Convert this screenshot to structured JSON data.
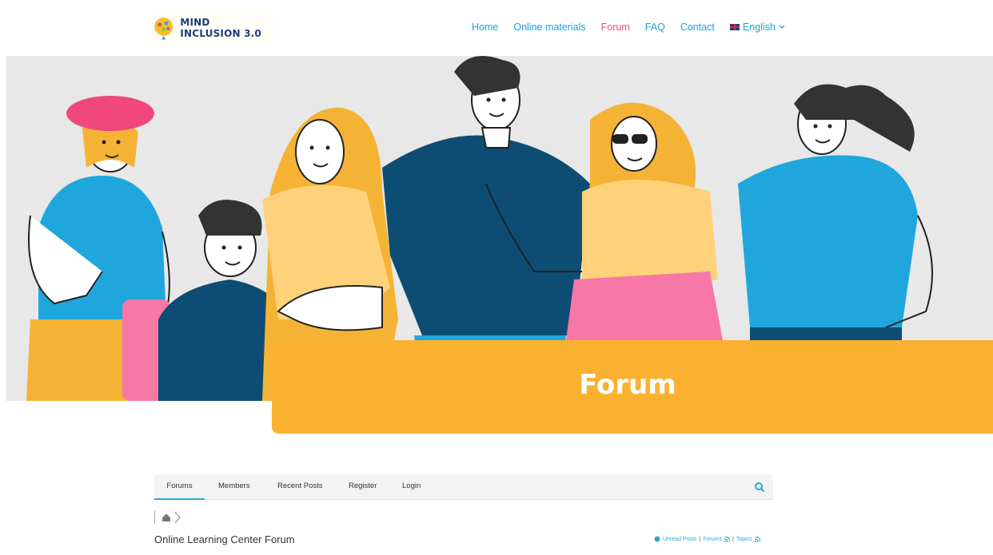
{
  "site": {
    "logo_text": "MIND INCLUSION 3.0"
  },
  "nav": {
    "items": [
      {
        "label": "Home"
      },
      {
        "label": "Online materials"
      },
      {
        "label": "Forum"
      },
      {
        "label": "FAQ"
      },
      {
        "label": "Contact"
      }
    ],
    "language": "English",
    "active": "Forum"
  },
  "banner": {
    "title": "Forum"
  },
  "forum_tabs": [
    {
      "label": "Forums"
    },
    {
      "label": "Members"
    },
    {
      "label": "Recent Posts"
    },
    {
      "label": "Register"
    },
    {
      "label": "Login"
    }
  ],
  "page": {
    "title": "Online Learning Center Forum"
  },
  "quick_links": {
    "unread": "Unread Posts",
    "forums": "Forums",
    "topics": "Topics"
  },
  "colors": {
    "accent": "#1aa3d8",
    "active_nav": "#f0487c",
    "banner": "#fbb130"
  },
  "icons": [
    "search-icon",
    "home-icon",
    "chevron-right-icon",
    "rss-icon",
    "flag-uk-icon",
    "chevron-down-icon"
  ]
}
